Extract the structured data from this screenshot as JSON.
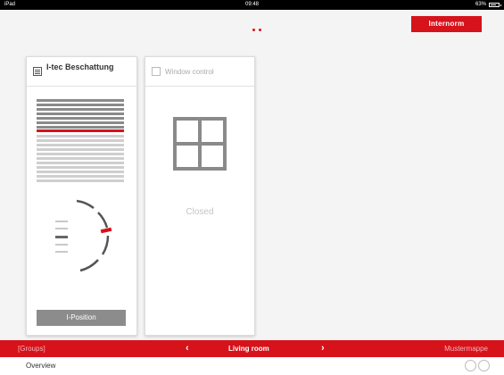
{
  "status_bar": {
    "device": "iPad",
    "time": "09:48",
    "battery": "63%"
  },
  "brand": {
    "logo_text": "Internorm",
    "accent_color": "#d6121b"
  },
  "cards": {
    "shading": {
      "title": "I-tec Beschattung",
      "button_label": "I-Position"
    },
    "window": {
      "title": "Window control",
      "state": "Closed"
    }
  },
  "bottom_bar": {
    "groups_label": "[Groups]",
    "room": "Living room",
    "prev_icon": "chevron-left-icon",
    "next_icon": "chevron-right-icon",
    "folder_label": "Mustermappe"
  },
  "footer": {
    "overview_label": "Overview"
  }
}
